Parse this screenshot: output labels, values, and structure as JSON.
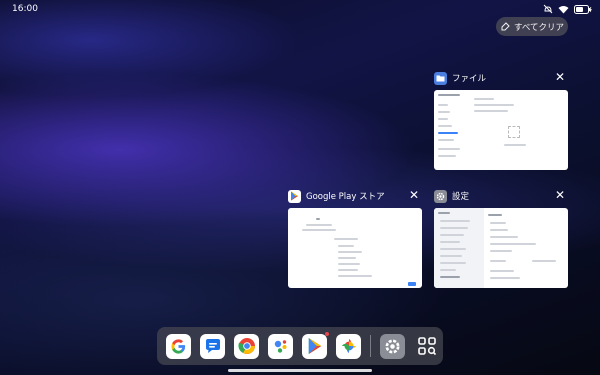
{
  "status_bar": {
    "time": "16:00"
  },
  "clear_all": {
    "label": "すべてクリア"
  },
  "recent_apps": [
    {
      "title": "ファイル"
    },
    {
      "title": "Google Play ストア"
    },
    {
      "title": "設定"
    }
  ],
  "dock": {
    "apps": [
      "Google",
      "メッセージ",
      "Chrome",
      "アシスタント",
      "Google Play ストア",
      "フォト",
      "設定",
      "アプリ一覧"
    ]
  },
  "colors": {
    "files_icon": "#4a7fe0",
    "settings_icon": "#8a8d95",
    "clear_all_bg": "#50505a"
  }
}
